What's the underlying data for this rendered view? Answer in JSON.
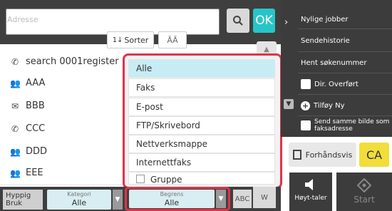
{
  "address": {
    "placeholder": "Adresse"
  },
  "buttons": {
    "ok": "OK"
  },
  "sort": {
    "label": "Sorter",
    "icon": "sort-icon",
    "display_icon": "display-toggle-icon"
  },
  "list": {
    "items": [
      {
        "icon": "phone-icon",
        "label": "search 0001register"
      },
      {
        "icon": "group-icon",
        "label": "AAA"
      },
      {
        "icon": "email-icon",
        "label": "BBB"
      },
      {
        "icon": "phone-icon",
        "label": "CCC"
      },
      {
        "icon": "group-icon",
        "label": "DDD"
      },
      {
        "icon": "group-icon",
        "label": "EEE"
      }
    ]
  },
  "dropdown": {
    "options": [
      "Alle",
      "Faks",
      "E-post",
      "FTP/Skrivebord",
      "Nettverksmappe",
      "Internettfaks",
      "Gruppe"
    ],
    "selected_index": 0
  },
  "right_panel": {
    "nylige_jobber": "Nylige jobber",
    "sendehistorie": "Sendehistorie",
    "hent_sokenummer": "Hent søkenummer",
    "dir_overfort": "Dir. Overført",
    "tilfoy_ny": "Tilføy Ny",
    "send_samme": "Send samme bilde som faksadresse",
    "forhandsvis": "Forhåndsvis",
    "ca": "CA"
  },
  "bottom": {
    "hyppig": "Hyppig Bruk",
    "kategori_label": "Kategori",
    "kategori_value": "Alle",
    "begrens_label": "Begrens",
    "begrens_value": "Alle",
    "abc": "ABC",
    "w": "W",
    "hoyttaler": "Høyt-taler",
    "start": "Start"
  },
  "colors": {
    "accent": "#28c5c8",
    "highlight": "#e0334a",
    "ca": "#f2dd3a",
    "selected": "#c8ecf3"
  }
}
